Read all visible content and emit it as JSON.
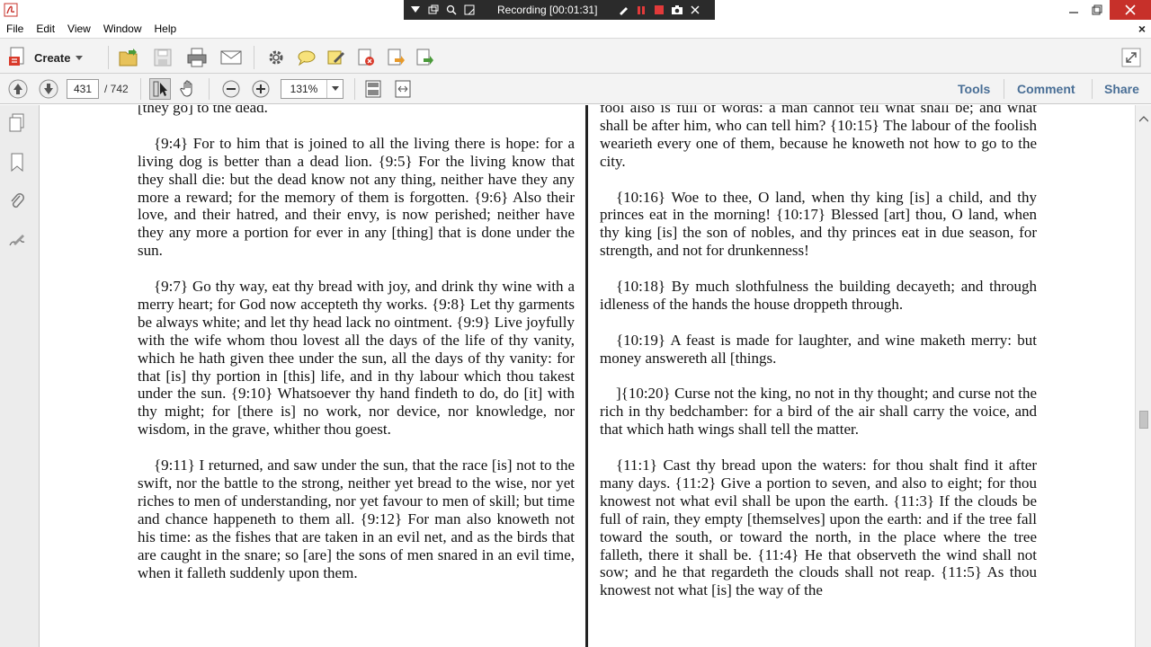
{
  "recording": {
    "label": "Recording [00:01:31]"
  },
  "menu": {
    "items": [
      "File",
      "Edit",
      "View",
      "Window",
      "Help"
    ]
  },
  "toolbar": {
    "create_label": "Create"
  },
  "navigation": {
    "current_page": "431",
    "total_pages": "/ 742",
    "zoom": "131%"
  },
  "right_links": {
    "tools": "Tools",
    "comment": "Comment",
    "share": "Share"
  },
  "colors": {
    "link": "#4a6f96",
    "close_red": "#c7302a",
    "recorder_bg": "#2b2b2b"
  },
  "document": {
    "left_column": [
      "[they go] to the dead.",
      "{9:4} For to him that is joined to all the living there is hope: for a living dog is better than a dead lion. {9:5} For the living know that they shall die: but the dead know not any thing, neither have they any more a reward; for the memory of them is forgotten. {9:6} Also their love, and their hatred, and their envy, is now perished; neither have they any more a portion for ever in any [thing] that is done under the sun.",
      "{9:7} Go thy way, eat thy bread with joy, and drink thy wine with a merry heart; for God now accepteth thy works. {9:8} Let thy garments be always white; and let thy head lack no ointment. {9:9} Live joyfully with the wife whom thou lovest all the days of the life of thy vanity, which he hath given thee under the sun, all the days of thy vanity: for that [is] thy portion in [this] life, and in thy labour which thou takest under the sun. {9:10} Whatsoever thy hand findeth to do, do [it] with thy might; for [there is] no work, nor device, nor knowledge, nor wisdom, in the grave, whither thou goest.",
      "{9:11} I returned, and saw under the sun, that the race [is] not to the swift, nor the battle to the strong, neither yet bread to the wise, nor yet riches to men of understanding, nor yet favour to men of skill; but time and chance happeneth to them all. {9:12} For man also knoweth not his time: as the fishes that are taken in an evil net, and as the birds that are caught in the snare; so [are] the sons of men snared in an evil time, when it falleth suddenly upon them."
    ],
    "right_column": [
      "fool also is full of words: a man cannot tell what shall be; and what shall be after him, who can tell him? {10:15} The labour of the foolish wearieth every one of them, because he knoweth not how to go to the city.",
      "{10:16} Woe to thee, O land, when thy king [is] a child, and thy princes eat in the morning! {10:17} Blessed [art] thou, O land, when thy king [is] the son of nobles, and thy princes eat in due season, for strength, and not for drunkenness!",
      "{10:18} By much slothfulness the building decayeth; and through idleness of the hands the house droppeth through.",
      "{10:19} A feast is made for laughter, and wine maketh merry: but money answereth all [things.",
      "]{10:20} Curse not the king, no not in thy thought; and curse not the rich in thy bedchamber: for a bird of the air shall carry the voice, and that which hath wings shall tell the matter.",
      "{11:1} Cast thy bread upon the waters: for thou shalt find it after many days. {11:2} Give a portion to seven, and also to eight; for thou knowest not what evil shall be upon the earth. {11:3} If the clouds be full of rain, they empty [themselves] upon the earth: and if the tree fall toward the south, or toward the north, in the place where the tree falleth, there it shall be. {11:4} He that observeth the wind shall not sow; and he that regardeth the clouds shall not reap. {11:5} As thou knowest not what [is] the way of the"
    ]
  }
}
